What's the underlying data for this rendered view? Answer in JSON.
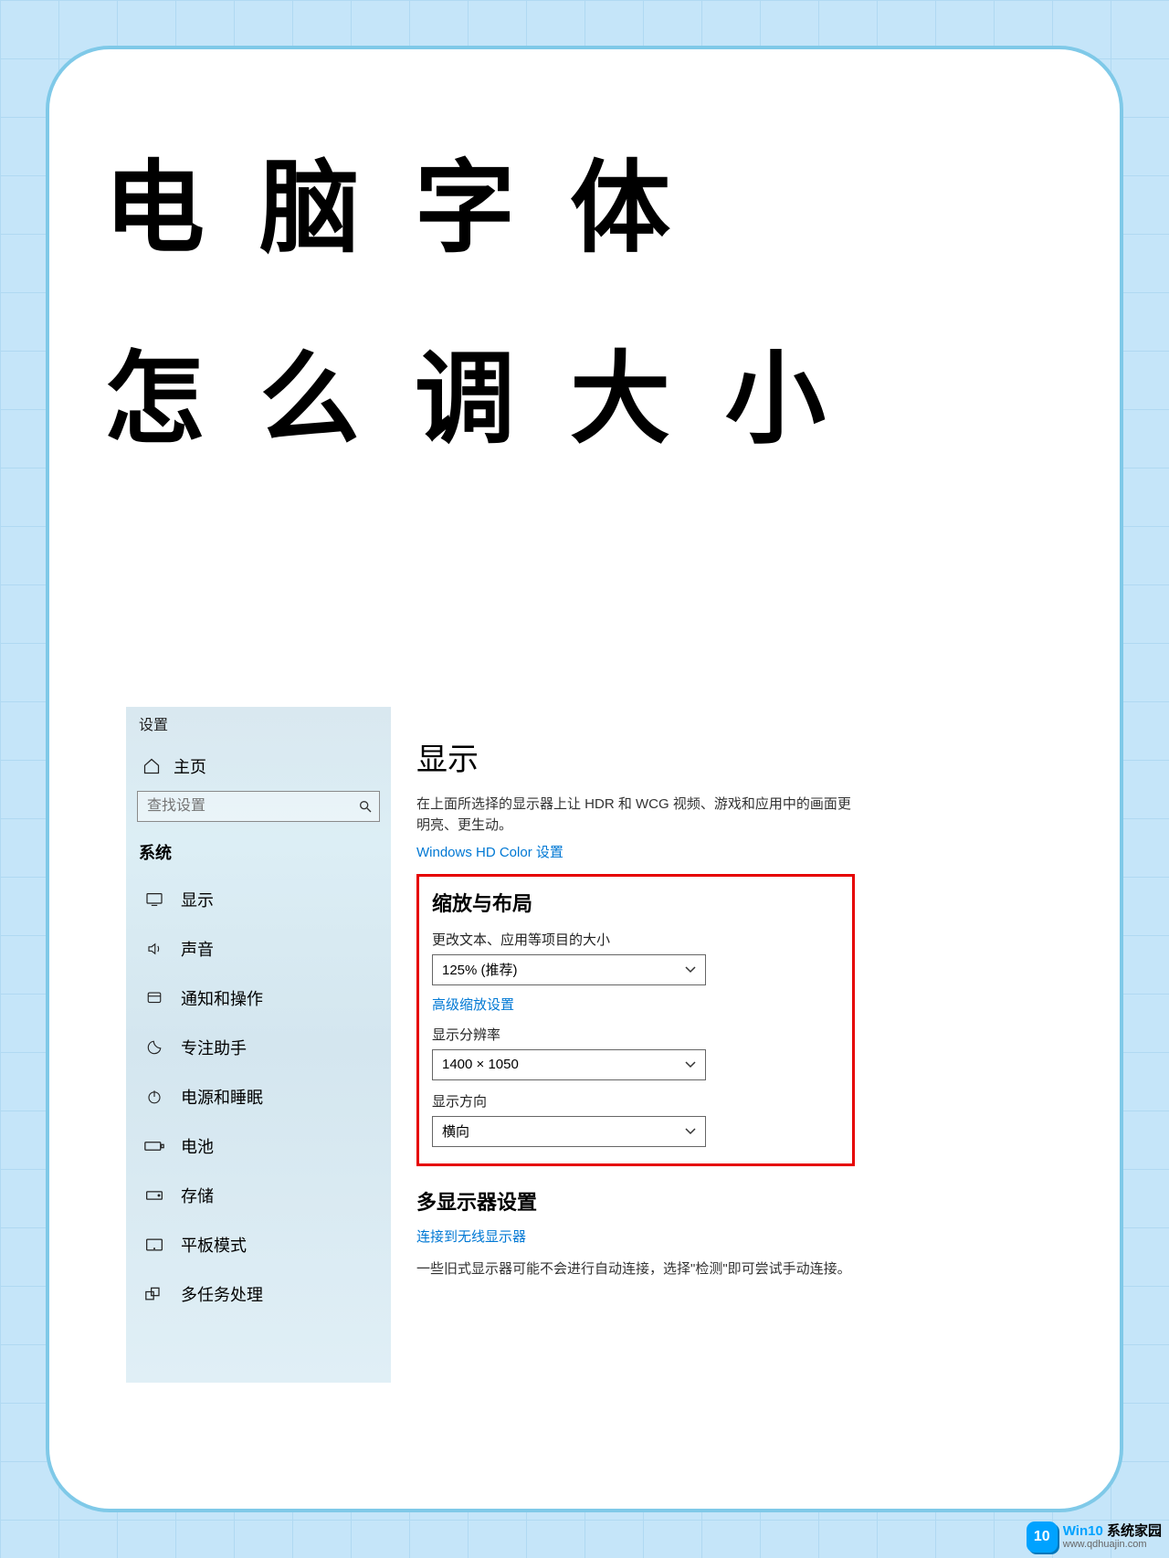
{
  "card": {
    "title_line1": "电脑字体",
    "title_line2": "怎么调大小"
  },
  "settings": {
    "window_title": "设置",
    "home": "主页",
    "search_placeholder": "查找设置",
    "category": "系统",
    "nav": [
      {
        "icon": "display",
        "label": "显示"
      },
      {
        "icon": "sound",
        "label": "声音"
      },
      {
        "icon": "notify",
        "label": "通知和操作"
      },
      {
        "icon": "focus",
        "label": "专注助手"
      },
      {
        "icon": "power",
        "label": "电源和睡眠"
      },
      {
        "icon": "battery",
        "label": "电池"
      },
      {
        "icon": "storage",
        "label": "存储"
      },
      {
        "icon": "tablet",
        "label": "平板模式"
      },
      {
        "icon": "multitask",
        "label": "多任务处理"
      }
    ],
    "content": {
      "page_title": "显示",
      "desc": "在上面所选择的显示器上让 HDR 和 WCG 视频、游戏和应用中的画面更明亮、更生动。",
      "hd_link": "Windows HD Color 设置",
      "scale_section": "缩放与布局",
      "scale_label": "更改文本、应用等项目的大小",
      "scale_value": "125% (推荐)",
      "advanced_scale": "高级缩放设置",
      "resolution_label": "显示分辨率",
      "resolution_value": "1400 × 1050",
      "orientation_label": "显示方向",
      "orientation_value": "横向",
      "multi_title": "多显示器设置",
      "wireless_link": "连接到无线显示器",
      "multi_desc": "一些旧式显示器可能不会进行自动连接，选择\"检测\"即可尝试手动连接。"
    }
  },
  "watermark": {
    "badge": "10",
    "line1a": "Win10",
    "line1b": " 系统家园",
    "line2": "www.qdhuajin.com"
  }
}
